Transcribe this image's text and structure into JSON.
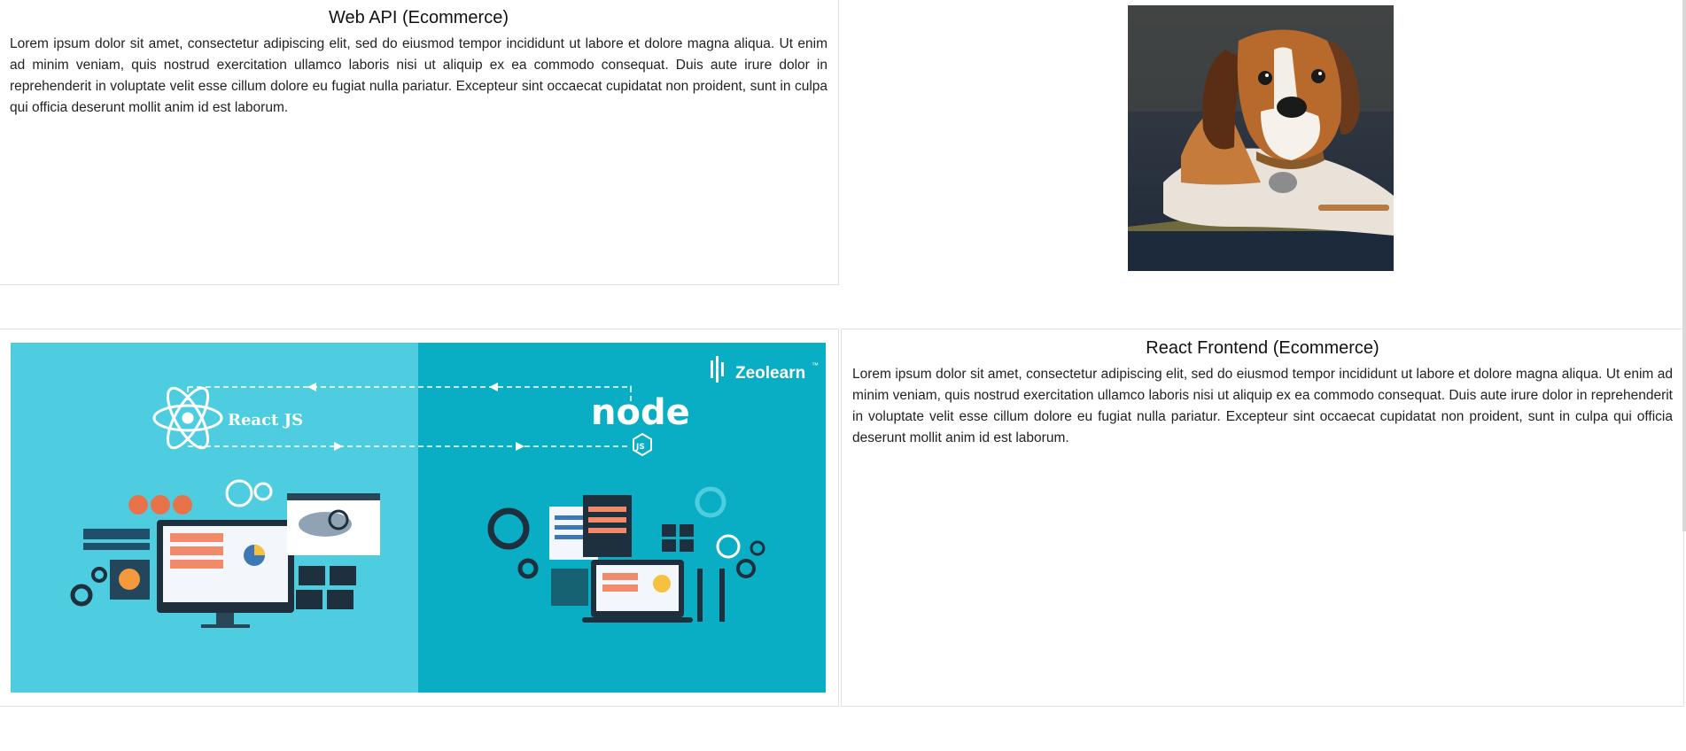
{
  "projects": [
    {
      "title": "Web API (Ecommerce)",
      "description": "Lorem ipsum dolor sit amet, consectetur adipiscing elit, sed do eiusmod tempor incididunt ut labore et dolore magna aliqua. Ut enim ad minim veniam, quis nostrud exercitation ullamco laboris nisi ut aliquip ex ea commodo consequat. Duis aute irure dolor in reprehenderit in voluptate velit esse cillum dolore eu fugiat nulla pariatur. Excepteur sint occaecat cupidatat non proident, sunt in culpa qui officia deserunt mollit anim id est laborum."
    },
    {
      "title": "React Frontend (Ecommerce)",
      "description": "Lorem ipsum dolor sit amet, consectetur adipiscing elit, sed do eiusmod tempor incididunt ut labore et dolore magna aliqua. Ut enim ad minim veniam, quis nostrud exercitation ullamco laboris nisi ut aliquip ex ea commodo consequat. Duis aute irure dolor in reprehenderit in voluptate velit esse cillum dolore eu fugiat nulla pariatur. Excepteur sint occaecat cupidatat non proident, sunt in culpa qui officia deserunt mollit anim id est laborum."
    }
  ],
  "banner": {
    "react_label": "React JS",
    "node_label": "node",
    "node_sub": "JS",
    "brand": "Zeolearn",
    "brand_mark": "™"
  },
  "colors": {
    "banner_left": "#4fcde0",
    "banner_right": "#0aaec4",
    "dog_bg": "#2a3342"
  }
}
